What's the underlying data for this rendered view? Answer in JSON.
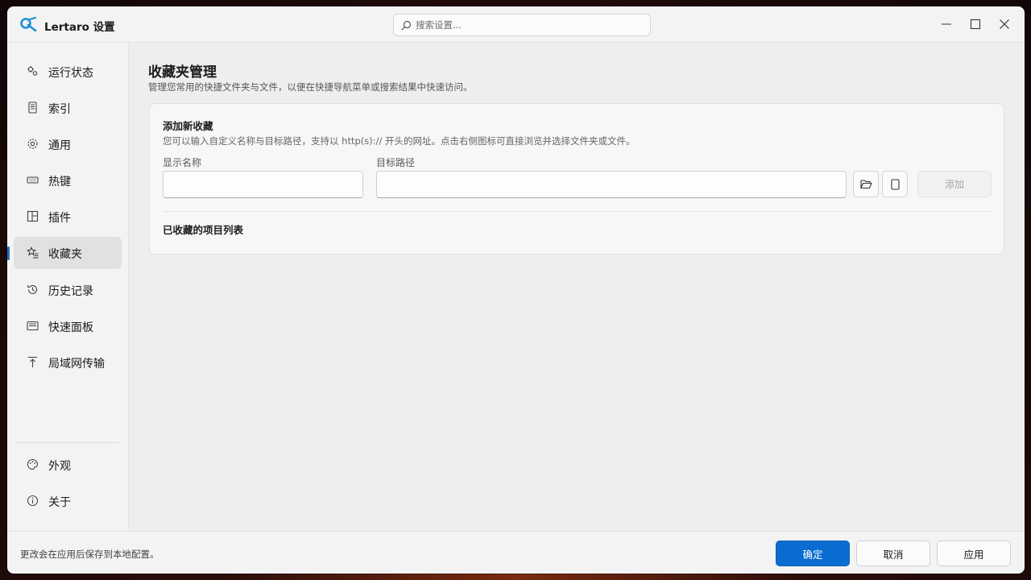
{
  "window": {
    "title": "Lertaro 设置",
    "controls": [
      "minimize-icon",
      "maximize-icon",
      "close-icon"
    ]
  },
  "search": {
    "placeholder": "搜索设置..."
  },
  "sidebar": {
    "items": [
      {
        "label": "运行状态",
        "icon": "status-gears-icon"
      },
      {
        "label": "索引",
        "icon": "index-doc-icon"
      },
      {
        "label": "通用",
        "icon": "gear-icon"
      },
      {
        "label": "热键",
        "icon": "keyboard-icon"
      },
      {
        "label": "插件",
        "icon": "plugin-grid-icon"
      },
      {
        "label": "收藏夹",
        "icon": "star-list-icon",
        "active": true
      },
      {
        "label": "历史记录",
        "icon": "history-icon"
      },
      {
        "label": "快速面板",
        "icon": "panel-icon"
      },
      {
        "label": "局域网传输",
        "icon": "upload-arrow-icon"
      }
    ],
    "bottom_items": [
      {
        "label": "外观",
        "icon": "palette-icon"
      },
      {
        "label": "关于",
        "icon": "info-icon"
      }
    ]
  },
  "main": {
    "title": "收藏夹管理",
    "subtitle": "管理您常用的快捷文件夹与文件，以便在快捷导航菜单或搜索结果中快速访问。",
    "add_card": {
      "title": "添加新收藏",
      "description": "您可以输入自定义名称与目标路径，支持以 http(s):// 开头的网址。点击右侧图标可直接浏览并选择文件夹或文件。",
      "name_label": "显示名称",
      "name_value": "",
      "path_label": "目标路径",
      "path_value": "",
      "add_button": "添加"
    },
    "list_title": "已收藏的项目列表"
  },
  "footer": {
    "note": "更改会在应用后保存到本地配置。",
    "ok": "确定",
    "cancel": "取消",
    "apply": "应用"
  },
  "colors": {
    "accent": "#0a6cd1",
    "active_indicator": "#1f6fbf"
  }
}
